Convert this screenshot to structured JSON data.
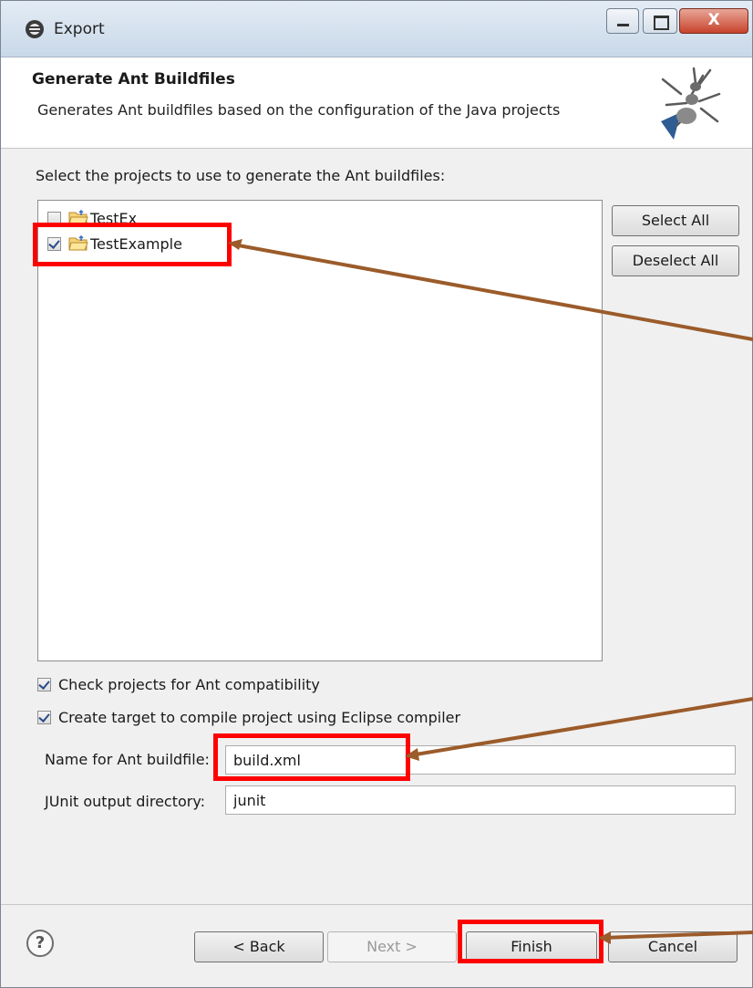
{
  "window": {
    "title": "Export",
    "close_glyph": "X"
  },
  "header": {
    "title": "Generate Ant Buildfiles",
    "description": "Generates Ant buildfiles based on the configuration of the Java projects"
  },
  "instruction": "Select the projects to use to generate the Ant buildfiles:",
  "projects": [
    {
      "name": "TestEx",
      "checked": false
    },
    {
      "name": "TestExample",
      "checked": true
    }
  ],
  "list_buttons": {
    "select_all": "Select All",
    "deselect_all": "Deselect All"
  },
  "options": [
    {
      "label": "Check projects for Ant compatibility",
      "checked": true
    },
    {
      "label": "Create target to compile project using Eclipse compiler",
      "checked": true
    }
  ],
  "fields": {
    "buildfile_label": "Name for Ant buildfile:",
    "buildfile_value": "build.xml",
    "junit_label": "JUnit output directory:",
    "junit_value": "junit"
  },
  "footer": {
    "help_glyph": "?",
    "back": "< Back",
    "next": "Next >",
    "finish": "Finish",
    "cancel": "Cancel"
  },
  "colors": {
    "highlight": "#ff0000",
    "arrow": "#9b5b2a"
  },
  "icons": [
    "app-icon",
    "ant-icon",
    "folder-project-icon",
    "help-icon"
  ]
}
